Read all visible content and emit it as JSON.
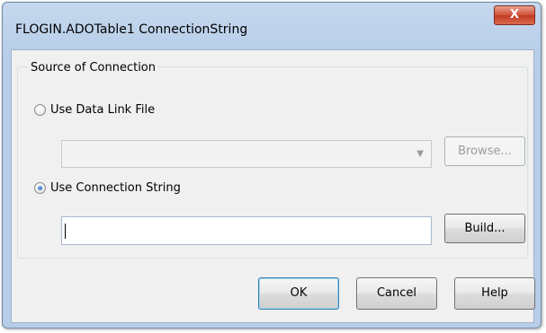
{
  "window": {
    "title": "FLOGIN.ADOTable1 ConnectionString",
    "close_label": "X"
  },
  "source_group": {
    "legend": "Source of Connection",
    "data_link": {
      "label": "Use Data Link File",
      "selected": false,
      "combo_value": "",
      "browse_label": "Browse...",
      "browse_enabled": false
    },
    "connection_string": {
      "label": "Use Connection String",
      "selected": true,
      "value": "",
      "build_label": "Build..."
    }
  },
  "buttons": {
    "ok": "OK",
    "cancel": "Cancel",
    "help": "Help"
  },
  "icons": {
    "close": "close-icon",
    "dropdown": "chevron-down-icon"
  }
}
